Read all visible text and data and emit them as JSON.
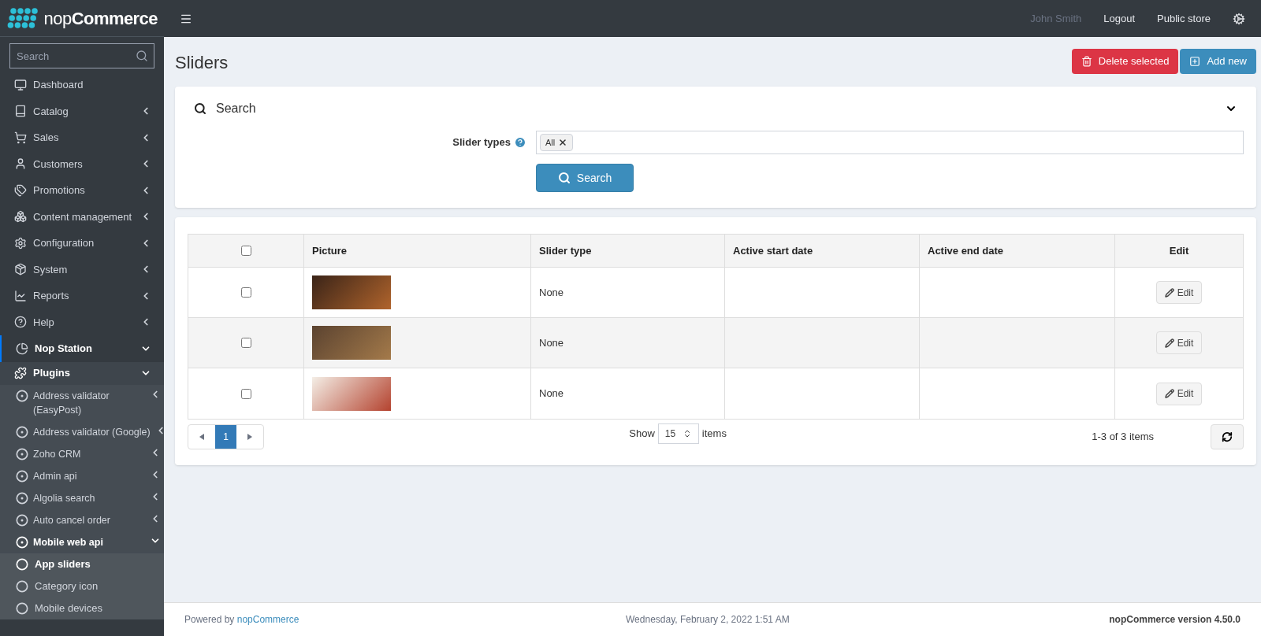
{
  "brand": {
    "prefix": "nop",
    "name": "Commerce"
  },
  "sidebar": {
    "search": {
      "placeholder": "Search"
    },
    "items": [
      {
        "label": "Dashboard"
      },
      {
        "label": "Catalog",
        "expanded": false
      },
      {
        "label": "Sales",
        "expanded": false
      },
      {
        "label": "Customers",
        "expanded": false
      },
      {
        "label": "Promotions",
        "expanded": false
      },
      {
        "label": "Content management",
        "expanded": false
      },
      {
        "label": "Configuration",
        "expanded": false
      },
      {
        "label": "System",
        "expanded": false
      },
      {
        "label": "Reports",
        "expanded": false
      },
      {
        "label": "Help",
        "expanded": false
      },
      {
        "label": "Nop Station",
        "expanded": true,
        "children": [
          {
            "label": "Plugins",
            "expanded": true,
            "children": [
              {
                "label": "Address validator (EasyPost)",
                "expanded": false
              },
              {
                "label": "Address validator (Google)",
                "expanded": false
              },
              {
                "label": "Zoho CRM",
                "expanded": false
              },
              {
                "label": "Admin api",
                "expanded": false
              },
              {
                "label": "Algolia search",
                "expanded": false
              },
              {
                "label": "Auto cancel order",
                "expanded": false
              },
              {
                "label": "Mobile web api",
                "expanded": true,
                "children": [
                  {
                    "label": "App sliders",
                    "selected": true
                  },
                  {
                    "label": "Category icon",
                    "selected": false
                  },
                  {
                    "label": "Mobile devices",
                    "selected": false
                  }
                ]
              }
            ]
          }
        ]
      }
    ]
  },
  "topbar": {
    "user": "John Smith",
    "links": [
      "Logout",
      "Public store"
    ]
  },
  "page": {
    "title": "Sliders",
    "buttons": [
      {
        "kind": "danger",
        "label": "Delete selected"
      },
      {
        "kind": "primary",
        "label": "Add new"
      }
    ]
  },
  "search_panel": {
    "title": "Search",
    "expanded": true,
    "field_label": "Slider types",
    "tags": [
      "All"
    ],
    "button": "Search"
  },
  "table": {
    "columns": [
      "Picture",
      "Slider type",
      "Active start date",
      "Active end date",
      "Edit"
    ],
    "all_checked": false,
    "rows": [
      {
        "checked": false,
        "slider_type": "None",
        "start": "",
        "end": "",
        "edit": "Edit"
      },
      {
        "checked": false,
        "slider_type": "None",
        "start": "",
        "end": "",
        "edit": "Edit"
      },
      {
        "checked": false,
        "slider_type": "None",
        "start": "",
        "end": "",
        "edit": "Edit"
      }
    ],
    "pager": {
      "pages": [
        {
          "label": "1",
          "selected": true
        }
      ],
      "show": "Show",
      "page_size": "15",
      "items": "items",
      "summary": "1-3 of 3 items"
    }
  },
  "footer": {
    "powered": "Powered by",
    "powered_link": "nopCommerce",
    "date": "Wednesday, February 2, 2022 1:51 AM",
    "version": "nopCommerce version 4.50.0"
  }
}
